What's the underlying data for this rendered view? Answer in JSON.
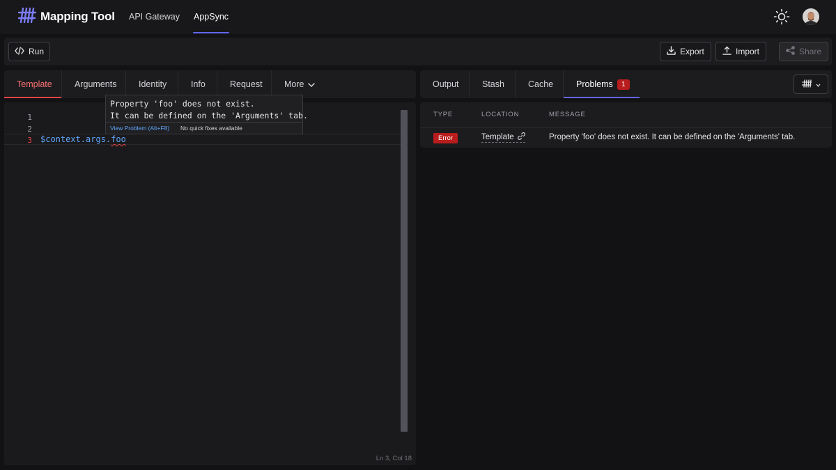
{
  "app": {
    "title": "Mapping Tool",
    "nav": [
      {
        "label": "API Gateway",
        "active": false
      },
      {
        "label": "AppSync",
        "active": true
      }
    ]
  },
  "toolbar": {
    "run_label": "Run",
    "export_label": "Export",
    "import_label": "Import",
    "share_label": "Share"
  },
  "left_tabs": [
    "Template",
    "Arguments",
    "Identity",
    "Info",
    "Request",
    "More"
  ],
  "right_tabs": {
    "output": "Output",
    "stash": "Stash",
    "cache": "Cache",
    "problems": "Problems",
    "problems_count": "1"
  },
  "editor": {
    "line_numbers": [
      "1",
      "2",
      "3"
    ],
    "code_prefix": "$context.args.",
    "code_error_token": "foo",
    "status": "Ln 3, Col 18"
  },
  "tooltip": {
    "message": "Property 'foo' does not exist.\nIt can be defined on the 'Arguments' tab.",
    "view_problem": "View Problem (Alt+F8)",
    "no_fixes": "No quick fixes available"
  },
  "problems": {
    "headers": {
      "type": "TYPE",
      "location": "LOCATION",
      "message": "MESSAGE"
    },
    "rows": [
      {
        "type": "Error",
        "location": "Template",
        "message": "Property 'foo' does not exist. It can be defined on the 'Arguments' tab."
      }
    ]
  },
  "colors": {
    "accent": "#6366f1",
    "error": "#ef4444",
    "code": "#60a5fa"
  },
  "icons": {
    "logo": "hash-grid-icon",
    "theme": "sun-icon",
    "run": "code-icon",
    "export": "download-icon",
    "import": "upload-icon",
    "share": "share-icon",
    "more": "chevron-down-icon",
    "layout": "grid-icon",
    "link": "link-icon"
  }
}
